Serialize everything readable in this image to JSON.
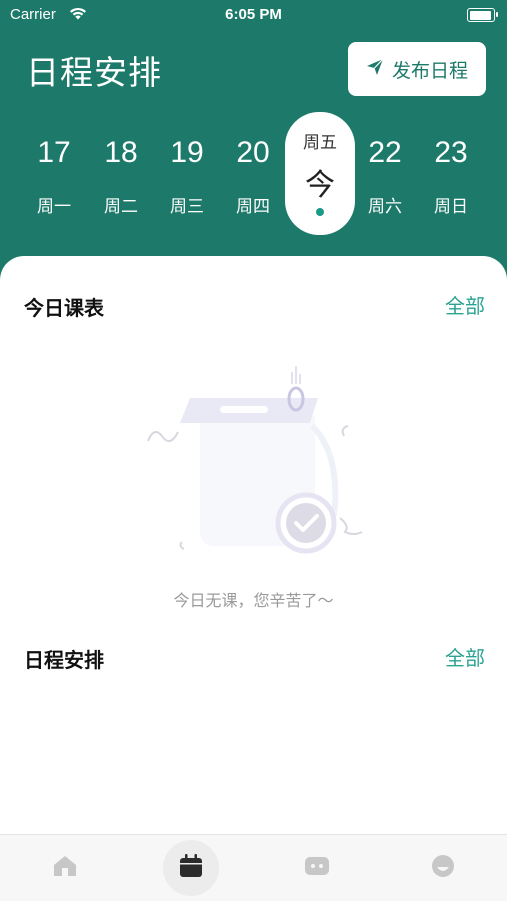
{
  "status_bar": {
    "carrier": "Carrier",
    "time": "6:05 PM"
  },
  "header": {
    "title": "日程安排",
    "publish_button": "发布日程"
  },
  "week": {
    "days": [
      {
        "date": "17",
        "weekday": "周一"
      },
      {
        "date": "18",
        "weekday": "周二"
      },
      {
        "date": "19",
        "weekday": "周三"
      },
      {
        "date": "20",
        "weekday": "周四"
      },
      {
        "date": "今",
        "weekday": "周五",
        "is_today": true
      },
      {
        "date": "22",
        "weekday": "周六"
      },
      {
        "date": "23",
        "weekday": "周日"
      }
    ]
  },
  "today_classes": {
    "title": "今日课表",
    "all_link": "全部",
    "empty_message": "今日无课，您辛苦了～"
  },
  "schedule": {
    "title": "日程安排",
    "all_link": "全部"
  },
  "tabbar": {
    "active_index": 1,
    "tabs": [
      {
        "icon": "home-icon"
      },
      {
        "icon": "calendar-icon"
      },
      {
        "icon": "message-icon"
      },
      {
        "icon": "profile-icon"
      }
    ],
    "colors": {
      "inactive": "#c7c7c7",
      "active": "#2b2b2b"
    }
  },
  "colors": {
    "primary": "#1d7a6a",
    "accent": "#2aa392"
  }
}
